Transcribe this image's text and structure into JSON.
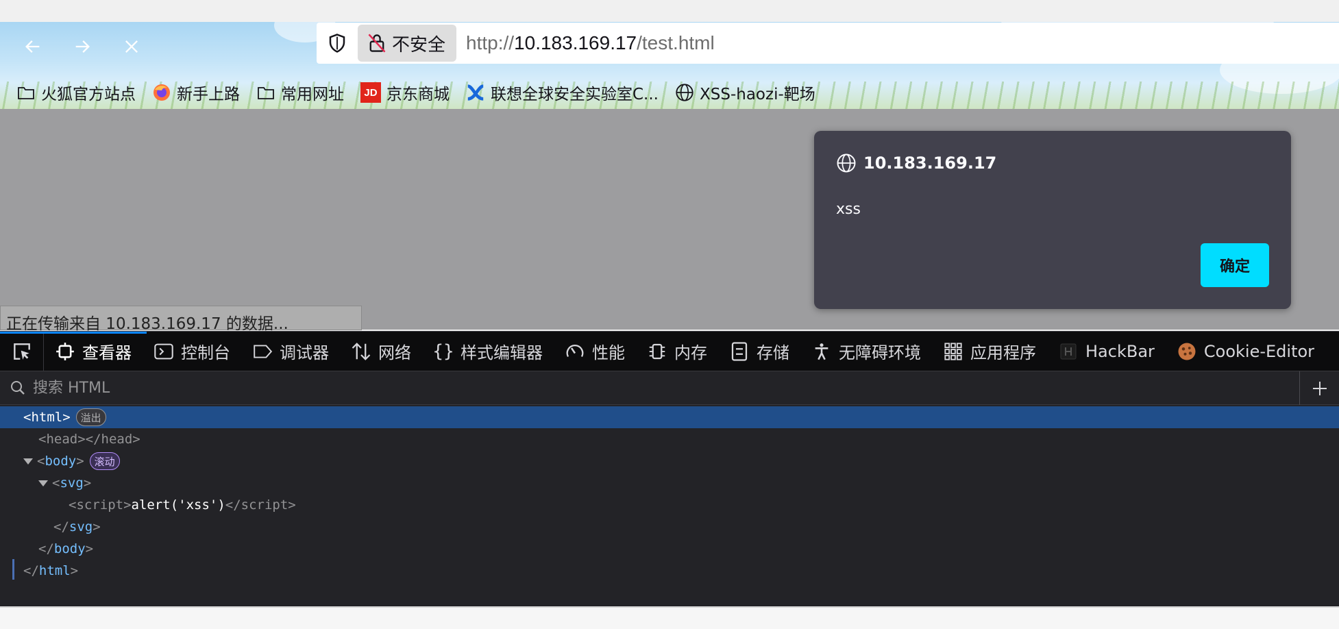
{
  "browser": {
    "nav": {
      "back_icon": "arrow-left-icon",
      "forward_icon": "arrow-right-icon",
      "stop_icon": "close-icon"
    },
    "urlbar": {
      "security_icon": "shield-icon",
      "insecure_label": "不安全",
      "url_scheme": "http://",
      "url_host": "10.183.169.17",
      "url_path": "/test.html"
    },
    "bookmarks": [
      {
        "label": "火狐官方站点",
        "icon": "folder-icon"
      },
      {
        "label": "新手上路",
        "icon": "firefox-icon"
      },
      {
        "label": "常用网址",
        "icon": "folder-icon"
      },
      {
        "label": "京东商城",
        "icon": "jd-icon",
        "icon_text": "JD"
      },
      {
        "label": "联想全球安全实验室C...",
        "icon": "lenovo-lab-icon"
      },
      {
        "label": "XSS-haozi-靶场",
        "icon": "globe-icon"
      }
    ]
  },
  "status_bar": {
    "text": "正在传输来自 10.183.169.17 的数据..."
  },
  "alert_dialog": {
    "host": "10.183.169.17",
    "message": "xss",
    "ok_label": "确定",
    "accent": "#00ddff"
  },
  "devtools": {
    "tabs": [
      {
        "label": "查看器",
        "icon": "inspector-icon",
        "active": true
      },
      {
        "label": "控制台",
        "icon": "console-icon"
      },
      {
        "label": "调试器",
        "icon": "debugger-icon"
      },
      {
        "label": "网络",
        "icon": "network-icon"
      },
      {
        "label": "样式编辑器",
        "icon": "braces-icon"
      },
      {
        "label": "性能",
        "icon": "performance-gauge-icon"
      },
      {
        "label": "内存",
        "icon": "memory-chip-icon"
      },
      {
        "label": "存储",
        "icon": "storage-icon"
      },
      {
        "label": "无障碍环境",
        "icon": "accessibility-icon"
      },
      {
        "label": "应用程序",
        "icon": "grid-icon"
      },
      {
        "label": "HackBar",
        "icon": "hackbar-icon"
      },
      {
        "label": "Cookie-Editor",
        "icon": "cookie-icon"
      }
    ],
    "search_placeholder": "搜索 HTML",
    "tree": {
      "html_badge": "溢出",
      "body_badge": "滚动",
      "script_text": "alert('xss')"
    }
  }
}
